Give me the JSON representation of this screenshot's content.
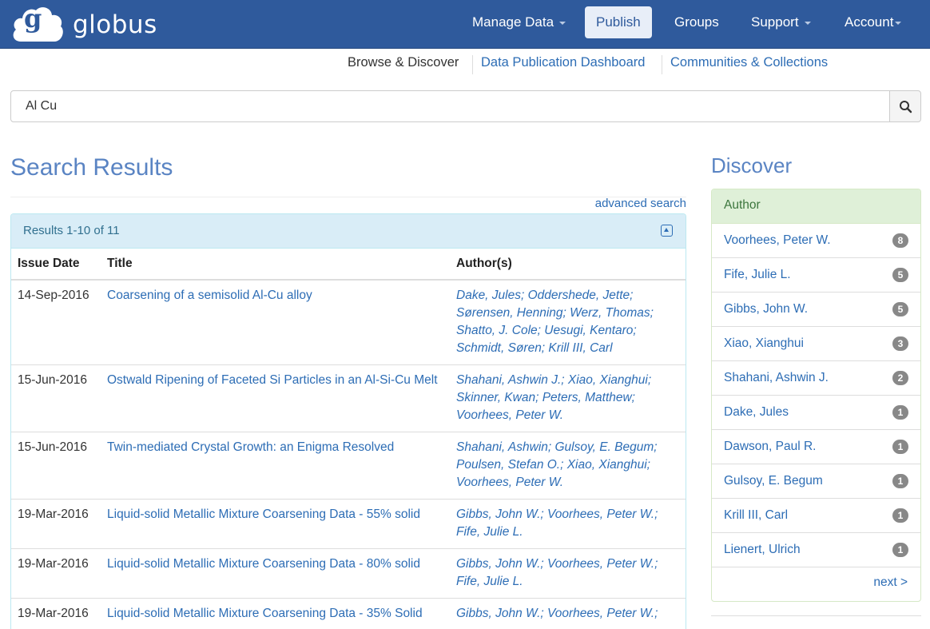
{
  "brand": {
    "name": "globus",
    "logo_letter": "g"
  },
  "topnav": {
    "items": [
      {
        "label": "Manage Data"
      },
      {
        "label": "Publish"
      },
      {
        "label": "Groups"
      },
      {
        "label": "Support"
      },
      {
        "label": "Account"
      }
    ]
  },
  "subnav": {
    "browse": "Browse & Discover",
    "dashboard": "Data Publication Dashboard",
    "communities": "Communities & Collections"
  },
  "search": {
    "value": "Al Cu",
    "icon": "search-icon"
  },
  "results": {
    "heading": "Search Results",
    "advanced_link": "advanced search",
    "count_label": "Results 1-10 of 11",
    "columns": [
      "Issue Date",
      "Title",
      "Author(s)"
    ],
    "rows": [
      {
        "date": "14-Sep-2016",
        "title": "Coarsening of a semisolid Al-Cu alloy",
        "authors": "Dake, Jules; Oddershede, Jette; Sørensen, Henning; Werz, Thomas; Shatto, J. Cole; Uesugi, Kentaro; Schmidt, Søren; Krill III, Carl"
      },
      {
        "date": "15-Jun-2016",
        "title": "Ostwald Ripening of Faceted Si Particles in an Al-Si-Cu Melt",
        "authors": "Shahani, Ashwin J.; Xiao, Xianghui; Skinner, Kwan; Peters, Matthew; Voorhees, Peter W."
      },
      {
        "date": "15-Jun-2016",
        "title": "Twin-mediated Crystal Growth: an Enigma Resolved",
        "authors": "Shahani, Ashwin; Gulsoy, E. Begum; Poulsen, Stefan O.; Xiao, Xianghui; Voorhees, Peter W."
      },
      {
        "date": "19-Mar-2016",
        "title": "Liquid-solid Metallic Mixture Coarsening Data - 55% solid",
        "authors": "Gibbs, John W.; Voorhees, Peter W.; Fife, Julie L."
      },
      {
        "date": "19-Mar-2016",
        "title": "Liquid-solid Metallic Mixture Coarsening Data - 80% solid",
        "authors": "Gibbs, John W.; Voorhees, Peter W.; Fife, Julie L."
      },
      {
        "date": "19-Mar-2016",
        "title": "Liquid-solid Metallic Mixture Coarsening Data - 35% Solid",
        "authors": "Gibbs, John W.; Voorhees, Peter W.;"
      }
    ]
  },
  "discover": {
    "heading": "Discover",
    "facet_title": "Author",
    "items": [
      {
        "name": "Voorhees, Peter W.",
        "count": "8"
      },
      {
        "name": "Fife, Julie L.",
        "count": "5"
      },
      {
        "name": "Gibbs, John W.",
        "count": "5"
      },
      {
        "name": "Xiao, Xianghui",
        "count": "3"
      },
      {
        "name": "Shahani, Ashwin J.",
        "count": "2"
      },
      {
        "name": "Dake, Jules",
        "count": "1"
      },
      {
        "name": "Dawson, Paul R.",
        "count": "1"
      },
      {
        "name": "Gulsoy, E. Begum",
        "count": "1"
      },
      {
        "name": "Krill III, Carl",
        "count": "1"
      },
      {
        "name": "Lienert, Ulrich",
        "count": "1"
      }
    ],
    "next": "next >"
  },
  "colors": {
    "nav_bg": "#2f5a9c",
    "link": "#2d6db5",
    "heading": "#5a84c3",
    "results_head_bg": "#d9edf7",
    "facet_head_bg": "#dff0d8"
  }
}
